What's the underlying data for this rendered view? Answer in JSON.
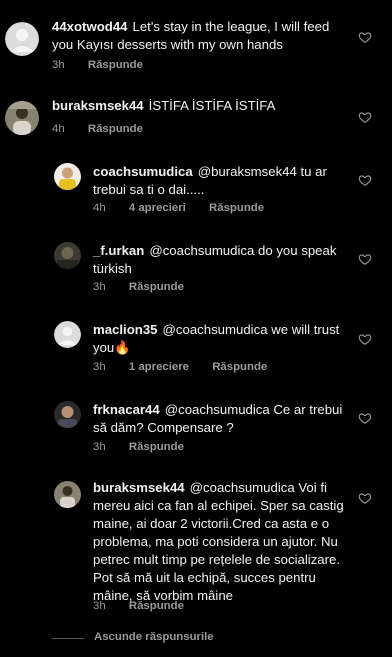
{
  "reply_label": "Răspunde",
  "colors": {
    "background": "#000000",
    "text": "#f2f2f2",
    "meta": "#9a9a9a"
  },
  "comments": [
    {
      "username": "44xotwod44",
      "text": "Let's stay in the league, I will feed you Kayısı desserts with my own hands",
      "time": "3h",
      "likes": "",
      "avatar": "default-avatar-icon"
    },
    {
      "username": "buraksmsek44",
      "text": "İSTİFA İSTİFA İSTİFA",
      "time": "4h",
      "likes": "",
      "avatar": "photo-avatar"
    }
  ],
  "replies": [
    {
      "username": "coachsumudica",
      "text": "@buraksmsek44 tu ar trebui sa ti o dai.....",
      "time": "4h",
      "likes": "4 aprecieri"
    },
    {
      "username": "_f.urkan",
      "text": "@coachsumudica do you speak türkish",
      "time": "3h",
      "likes": ""
    },
    {
      "username": "maclion35",
      "text": "@coachsumudica we will trust you🔥",
      "time": "3h",
      "likes": "1 apreciere"
    },
    {
      "username": "frknacar44",
      "text": "@coachsumudica Ce ar trebui să dăm? Compensare ?",
      "time": "3h",
      "likes": ""
    },
    {
      "username": "buraksmsek44",
      "text": "@coachsumudica Voi fi mereu aici ca fan al echipei. Sper sa castig maine, ai doar 2 victorii.Cred ca asta e o problema, ma poti considera un ajutor. Nu petrec mult timp pe rețelele de socializare. Pot să mă uit la echipă, succes pentru mâine, să vorbim mâine",
      "time": "3h",
      "likes": ""
    }
  ],
  "hide_replies_label": "Ascunde răspunsurile"
}
